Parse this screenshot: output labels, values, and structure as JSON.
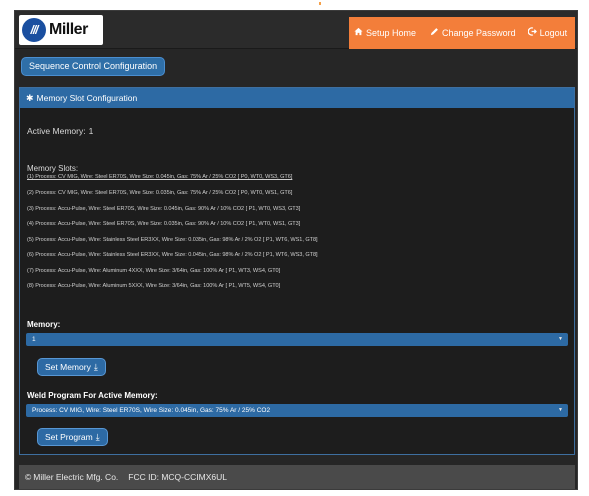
{
  "header": {
    "logo_mark": "///",
    "logo_text": "Miller",
    "nav": {
      "home": {
        "icon": "home-icon",
        "label": "Setup Home"
      },
      "password": {
        "icon": "pencil-icon",
        "label": "Change Password"
      },
      "logout": {
        "icon": "logout-icon",
        "label": "Logout"
      }
    },
    "accent_color": "#f37e3a"
  },
  "sequence_button": "Sequence Control Configuration",
  "panel": {
    "title": "Memory Slot Configuration",
    "title_icon": "gear-icon",
    "active_memory_label": "Active Memory:",
    "active_memory_value": "1",
    "slots_title": "Memory Slots:",
    "slots": [
      "(1) Process: CV MIG, Wire: Steel ER70S, Wire Size: 0.045in, Gas: 75% Ar / 25% CO2 [ P0, WT0, WS3, GT6]",
      "(2) Process: CV MIG, Wire: Steel ER70S, Wire Size: 0.035in, Gas: 75% Ar / 25% CO2 [ P0, WT0, WS1, GT6]",
      "(3) Process: Accu-Pulse, Wire: Steel ER70S, Wire Size: 0.045in, Gas: 90% Ar / 10% CO2 [ P1, WT0, WS3, GT3]",
      "(4) Process: Accu-Pulse, Wire: Steel ER70S, Wire Size: 0.035in, Gas: 90% Ar / 10% CO2 [ P1, WT0, WS1, GT3]",
      "(5) Process: Accu-Pulse, Wire: Stainless Steel ER3XX, Wire Size: 0.035in, Gas: 98% Ar / 2% O2 [ P1, WT6, WS1, GT8]",
      "(6) Process: Accu-Pulse, Wire: Stainless Steel ER3XX, Wire Size: 0.045in, Gas: 98% Ar / 2% O2 [ P1, WT6, WS3, GT8]",
      "(7) Process: Accu-Pulse, Wire: Aluminum 4XXX, Wire Size: 3/64in, Gas: 100% Ar [ P1, WT3, WS4, GT0]",
      "(8) Process: Accu-Pulse, Wire: Aluminum 5XXX, Wire Size: 3/64in, Gas: 100% Ar [ P1, WT5, WS4, GT0]"
    ],
    "memory_label": "Memory:",
    "memory_selected": "1",
    "set_memory_label": "Set Memory",
    "weld_program_label": "Weld Program For Active Memory:",
    "weld_program_selected": "Process: CV MIG, Wire: Steel ER70S, Wire Size: 0.045in, Gas: 75% Ar / 25% CO2",
    "set_program_label": "Set Program"
  },
  "footer": {
    "copyright_symbol": "©",
    "company": "Miller Electric Mfg. Co.",
    "fcc": "FCC ID: MCQ-CCIMX6UL"
  }
}
